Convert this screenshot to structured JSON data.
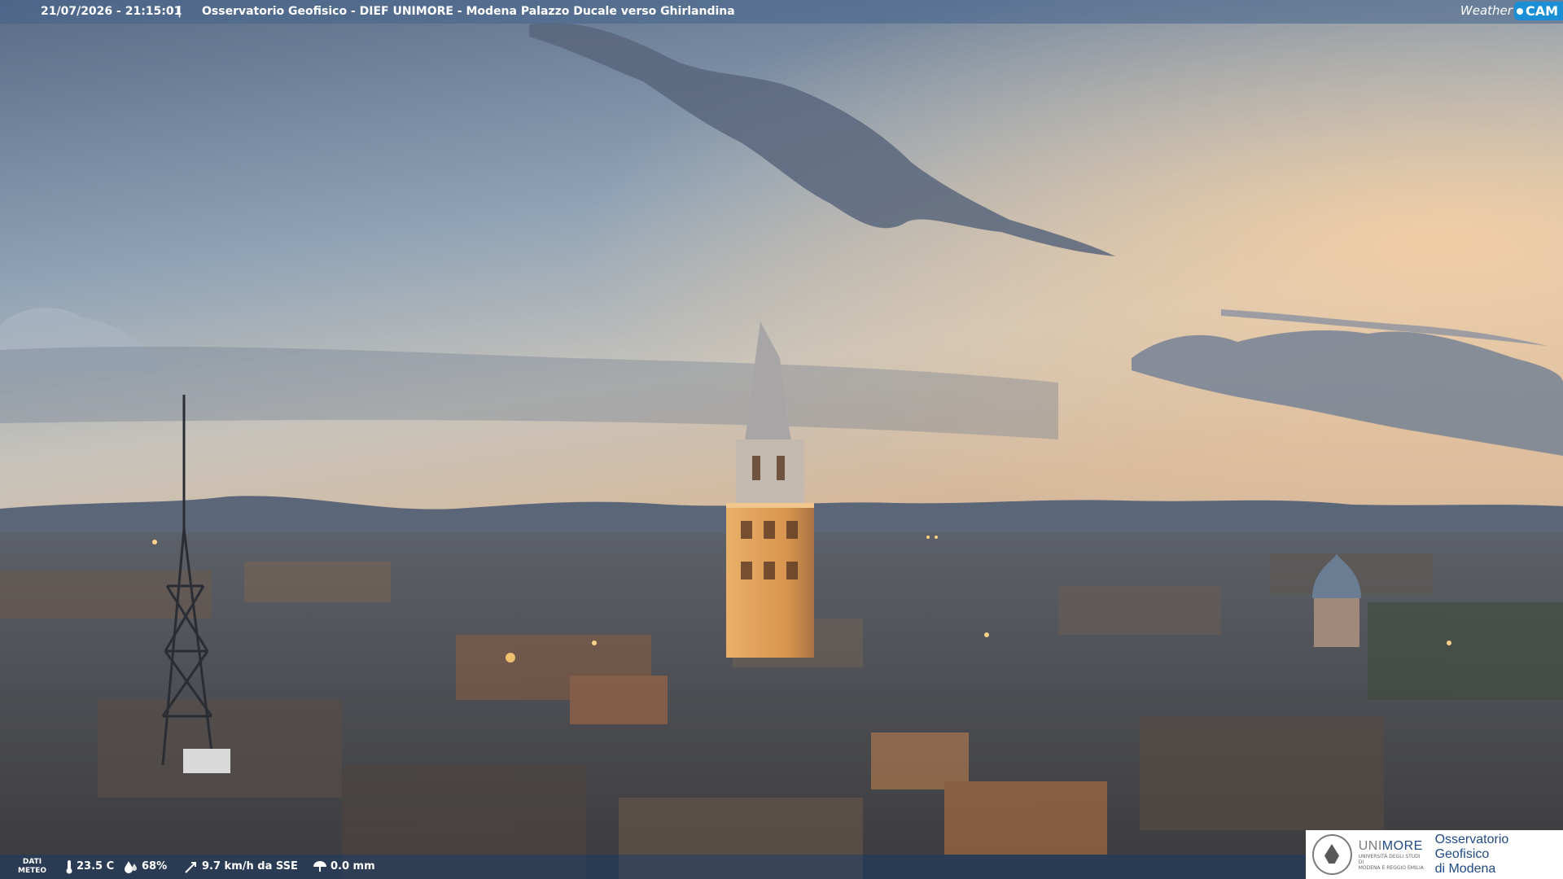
{
  "header": {
    "datetime": "21/07/2026 - 21:15:01",
    "separator": "|",
    "title": "Osservatorio Geofisico - DIEF UNIMORE - Modena Palazzo Ducale verso Ghirlandina",
    "brand_word": "Weather",
    "brand_badge": "CAM"
  },
  "footer": {
    "label_line1": "DATI",
    "label_line2": "METEO",
    "temperature": "23.5 C",
    "humidity": "68%",
    "wind": "9.7 km/h da SSE",
    "rain": "0.0 mm",
    "icons": [
      "thermometer-icon",
      "humidity-drop-icon",
      "wind-icon",
      "rain-icon"
    ]
  },
  "logo": {
    "uni_prefix": "UNI",
    "uni_suffix": "MORE",
    "uni_sub1": "UNIVERSITÀ DEGLI STUDI DI",
    "uni_sub2": "MODENA E REGGIO EMILIA",
    "observatory_line1": "Osservatorio Geofisico",
    "observatory_line2": "di Modena"
  },
  "colors": {
    "sky_top": "#5a6b86",
    "sky_horizon": "#f2cfa6",
    "tower_lit": "#e8a55a",
    "brand_blue": "#1a8fd6",
    "unimore_blue": "#1f4a86"
  }
}
